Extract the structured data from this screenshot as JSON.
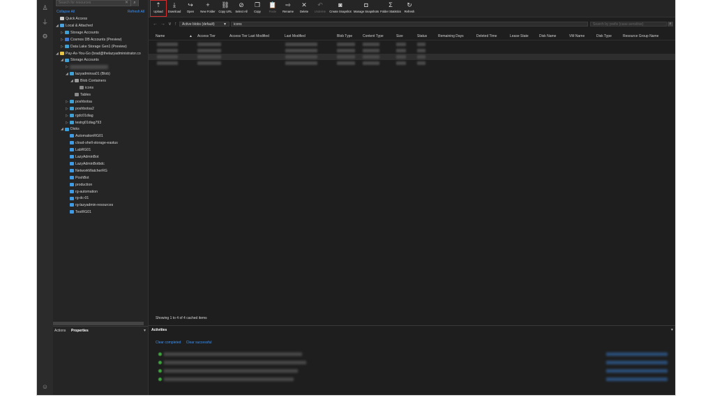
{
  "activity_bar": {
    "icons": [
      "account-icon",
      "connect-plug-icon",
      "settings-gear-icon",
      "feedback-icon"
    ]
  },
  "explorer": {
    "search_placeholder": "Search for resources",
    "collapse_all": "Collapse All",
    "refresh_all": "Refresh All",
    "tree": [
      {
        "label": "Quick Access",
        "level": 0,
        "icon": "quick-access-icon",
        "twisty": ""
      },
      {
        "label": "Local & Attached",
        "level": 0,
        "icon": "local-attached-icon",
        "twisty": "◢"
      },
      {
        "label": "Storage Accounts",
        "level": 1,
        "icon": "storage-account-icon",
        "twisty": "▷"
      },
      {
        "label": "Cosmos DB Accounts (Preview)",
        "level": 1,
        "icon": "cosmos-icon",
        "twisty": "▷"
      },
      {
        "label": "Data Lake Storage Gen1 (Preview)",
        "level": 1,
        "icon": "datalake-icon",
        "twisty": "▷"
      },
      {
        "label": "Pay-As-You-Go (brad@thelazyadministrator.co",
        "level": 0,
        "icon": "subscription-key-icon",
        "twisty": "◢"
      },
      {
        "label": "Storage Accounts",
        "level": 1,
        "icon": "storage-account-icon",
        "twisty": "◢"
      },
      {
        "label": "",
        "level": 2,
        "icon": "",
        "twisty": "▷",
        "blurred": true
      },
      {
        "label": "lazyadminsa01 (Blob)",
        "level": 2,
        "icon": "storage-account-icon",
        "twisty": "◢"
      },
      {
        "label": "Blob Containers",
        "level": 3,
        "icon": "blob-containers-icon",
        "twisty": "◢"
      },
      {
        "label": "icons",
        "level": 4,
        "icon": "container-icon",
        "twisty": ""
      },
      {
        "label": "Tables",
        "level": 3,
        "icon": "tables-icon",
        "twisty": ""
      },
      {
        "label": "poshbotsa",
        "level": 2,
        "icon": "storage-account-icon",
        "twisty": "▷"
      },
      {
        "label": "poshbotsa2",
        "level": 2,
        "icon": "storage-account-icon",
        "twisty": "▷"
      },
      {
        "label": "rgdc01diag",
        "level": 2,
        "icon": "storage-account-icon",
        "twisty": "▷"
      },
      {
        "label": "testrg01diag793",
        "level": 2,
        "icon": "storage-account-icon",
        "twisty": "▷"
      },
      {
        "label": "Disks",
        "level": 1,
        "icon": "disks-icon",
        "twisty": "◢"
      },
      {
        "label": "AutomationRG01",
        "level": 2,
        "icon": "resource-group-icon",
        "twisty": ""
      },
      {
        "label": "cloud-shell-storage-eastus",
        "level": 2,
        "icon": "resource-group-icon",
        "twisty": ""
      },
      {
        "label": "LabRG01",
        "level": 2,
        "icon": "resource-group-icon",
        "twisty": ""
      },
      {
        "label": "LazyAdminBot",
        "level": 2,
        "icon": "resource-group-icon",
        "twisty": ""
      },
      {
        "label": "LazyAdminBotbdc",
        "level": 2,
        "icon": "resource-group-icon",
        "twisty": ""
      },
      {
        "label": "NetworkWatcherRG",
        "level": 2,
        "icon": "resource-group-icon",
        "twisty": ""
      },
      {
        "label": "PoshBot",
        "level": 2,
        "icon": "resource-group-icon",
        "twisty": ""
      },
      {
        "label": "production",
        "level": 2,
        "icon": "resource-group-icon",
        "twisty": ""
      },
      {
        "label": "rg-automation",
        "level": 2,
        "icon": "resource-group-icon",
        "twisty": ""
      },
      {
        "label": "rg-dc-01",
        "level": 2,
        "icon": "resource-group-icon",
        "twisty": ""
      },
      {
        "label": "rg-lazyadmin-resources",
        "level": 2,
        "icon": "resource-group-icon",
        "twisty": ""
      },
      {
        "label": "TestRG01",
        "level": 2,
        "icon": "resource-group-icon",
        "twisty": ""
      }
    ]
  },
  "lower_panel": {
    "tab_actions": "Actions",
    "tab_properties": "Properties"
  },
  "toolbar": {
    "buttons": [
      {
        "label": "Upload",
        "icon": "upload-icon",
        "glyph": "⇡",
        "disabled": false,
        "selected": true
      },
      {
        "label": "Download",
        "icon": "download-icon",
        "glyph": "⤓",
        "disabled": false
      },
      {
        "label": "Open",
        "icon": "open-icon",
        "glyph": "↪",
        "disabled": false
      },
      {
        "label": "New Folder",
        "icon": "new-folder-icon",
        "glyph": "+",
        "disabled": false
      },
      {
        "label": "Copy URL",
        "icon": "copy-url-icon",
        "glyph": "⛓",
        "disabled": false
      },
      {
        "label": "Select All",
        "icon": "select-all-icon",
        "glyph": "⊘",
        "disabled": false
      },
      {
        "label": "Copy",
        "icon": "copy-icon",
        "glyph": "❐",
        "disabled": false
      },
      {
        "label": "Paste",
        "icon": "paste-icon",
        "glyph": "📋",
        "disabled": true
      },
      {
        "label": "Rename",
        "icon": "rename-icon",
        "glyph": "⇨",
        "disabled": false
      },
      {
        "label": "Delete",
        "icon": "delete-icon",
        "glyph": "✕",
        "disabled": false
      },
      {
        "label": "Undelete",
        "icon": "undelete-icon",
        "glyph": "↶",
        "disabled": true
      },
      {
        "label": "Create Snapshot",
        "icon": "create-snapshot-icon",
        "glyph": "◙",
        "disabled": false
      },
      {
        "label": "Manage Snapshots",
        "icon": "manage-snapshots-icon",
        "glyph": "◘",
        "disabled": false
      },
      {
        "label": "Folder Statistics",
        "icon": "sigma-icon",
        "glyph": "Σ",
        "disabled": false
      },
      {
        "label": "Refresh",
        "icon": "refresh-icon",
        "glyph": "↻",
        "disabled": false
      }
    ]
  },
  "nav": {
    "view_selected": "Active blobs (default)",
    "path": "icons",
    "prefix_placeholder": "Search by prefix (case-sensitive)"
  },
  "table": {
    "columns": [
      "Name",
      "Access Tier",
      "Access Tier Last Modified",
      "Last Modified",
      "Blob Type",
      "Content Type",
      "Size",
      "Status",
      "Remaining Days",
      "Deleted Time",
      "Lease State",
      "Disk Name",
      "VM Name",
      "Disk Type",
      "Resource Group Name"
    ],
    "row_count": 4
  },
  "status": {
    "text": "Showing 1 to 4 of 4 cached items"
  },
  "activities": {
    "title": "Activities",
    "clear_completed": "Clear completed",
    "clear_successful": "Clear successful",
    "item_count": 4
  },
  "colors": {
    "accent": "#3794ff",
    "success": "#3fa83f",
    "selection_outline": "#d32f2f",
    "background": "#1e1e1e"
  }
}
